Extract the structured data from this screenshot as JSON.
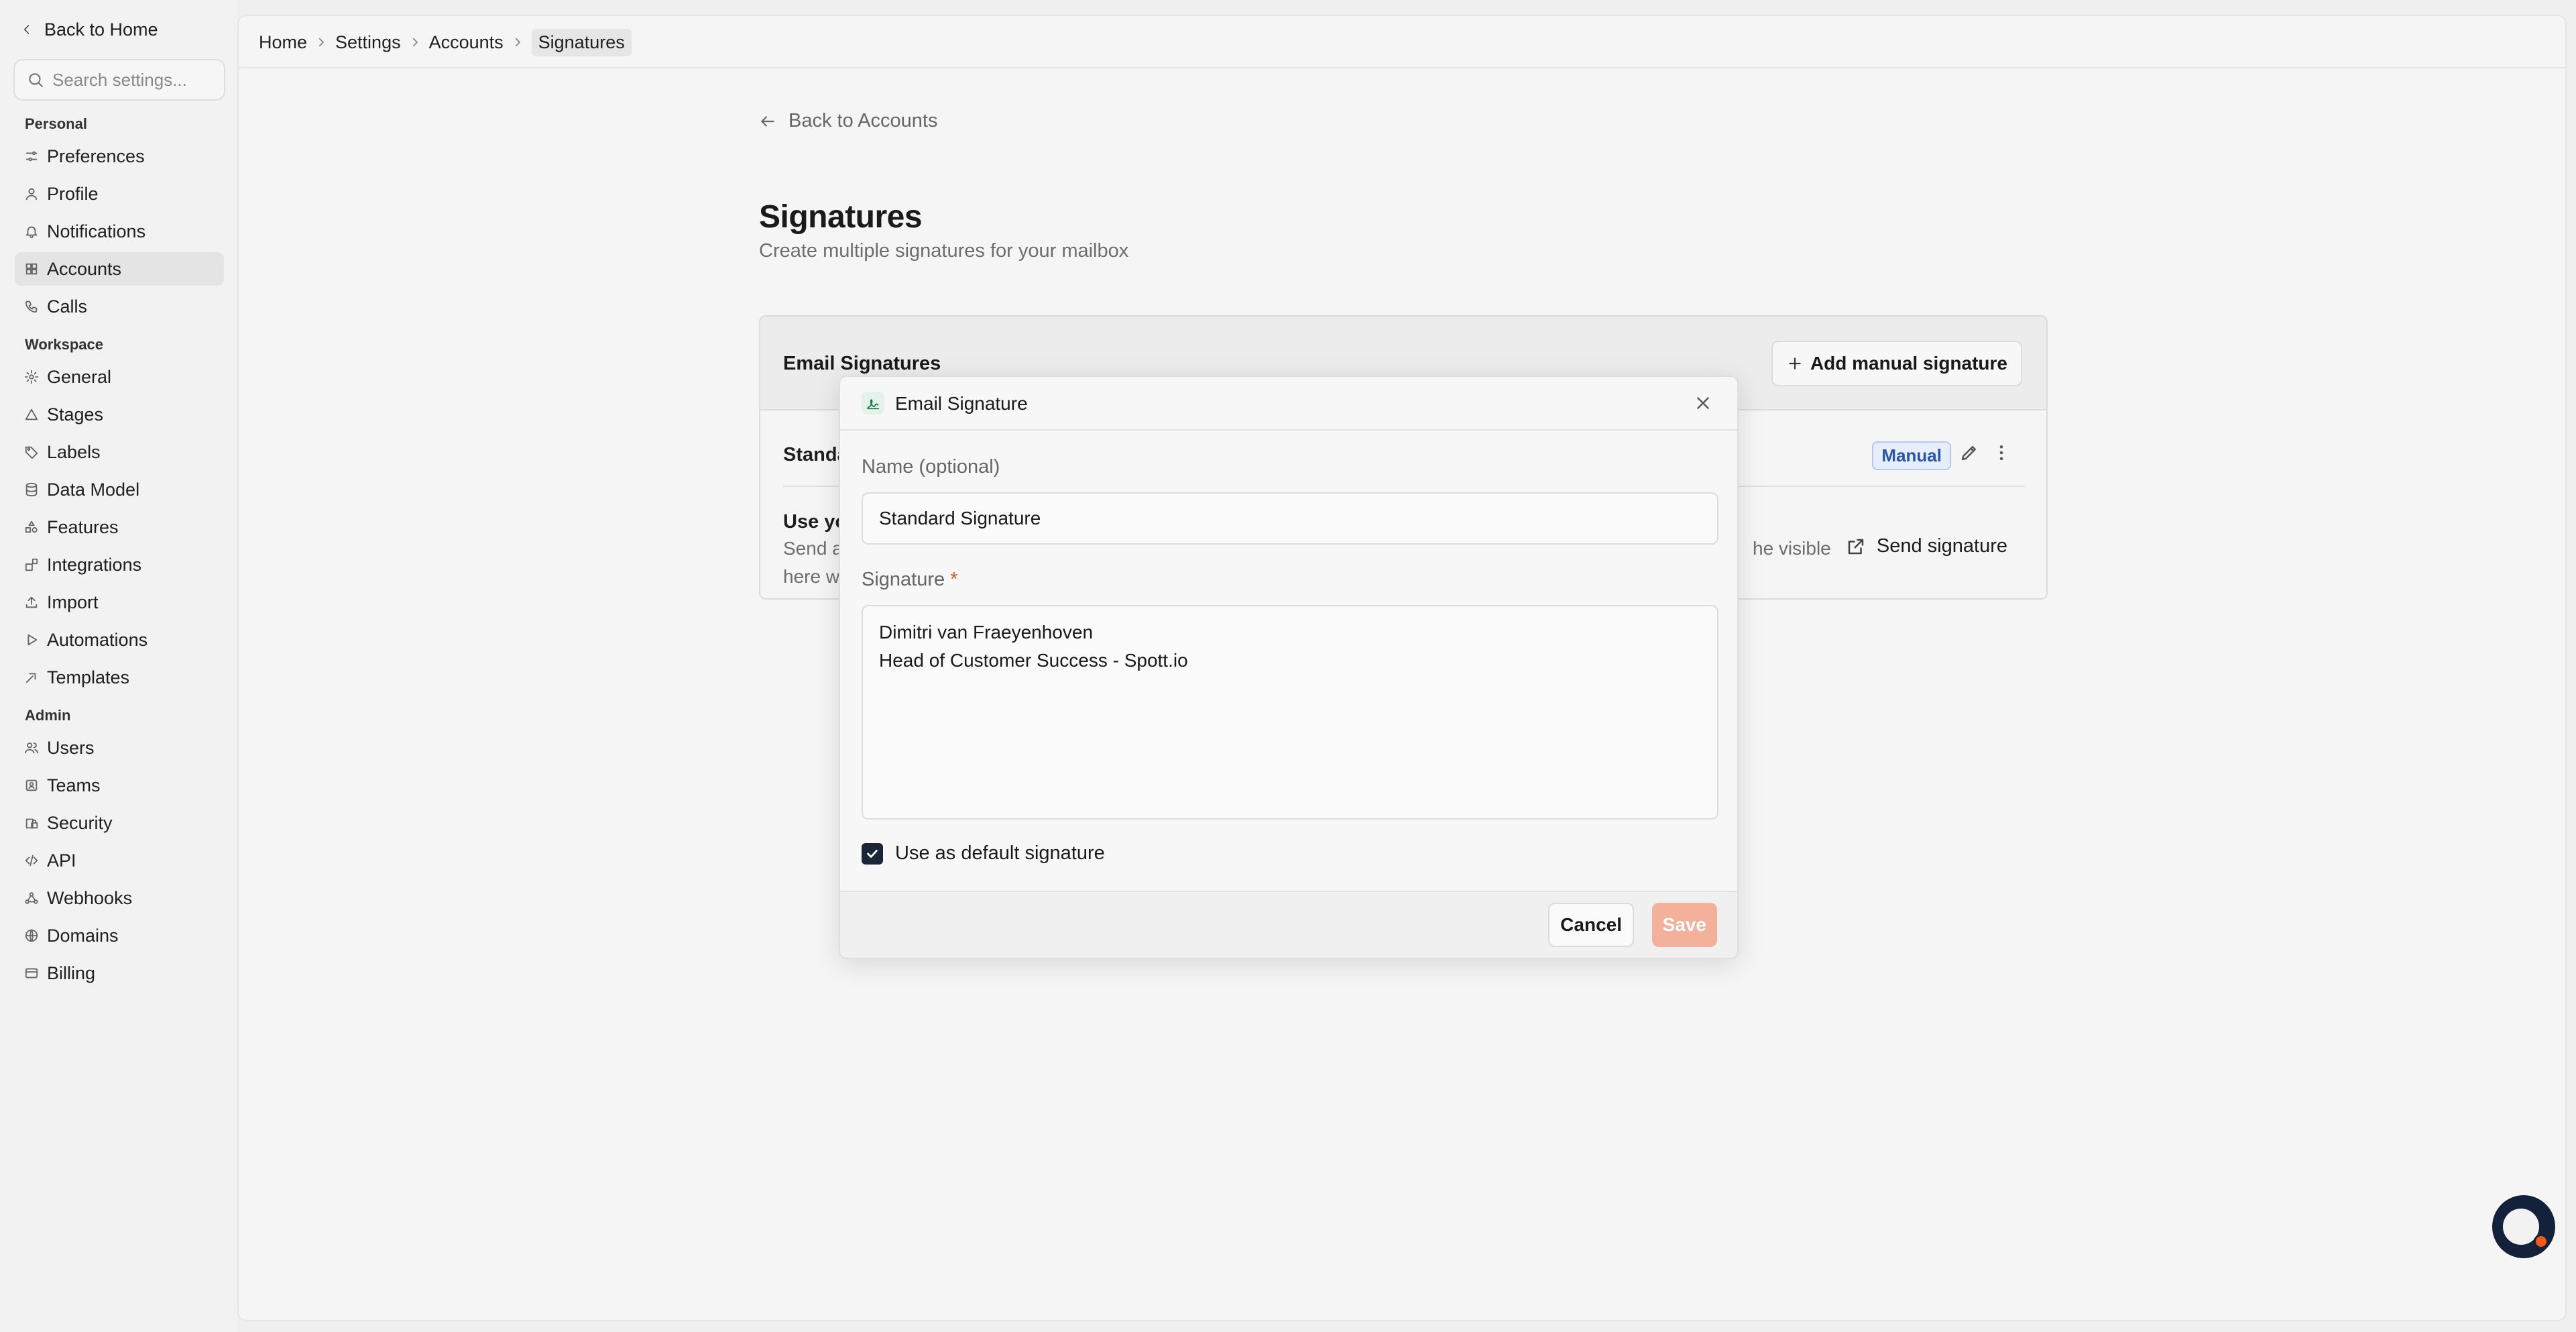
{
  "sidebar": {
    "back_label": "Back to Home",
    "search_placeholder": "Search settings...",
    "sections": {
      "personal": "Personal",
      "workspace": "Workspace",
      "admin": "Admin"
    },
    "items": [
      {
        "label": "Preferences",
        "icon": "sliders-icon"
      },
      {
        "label": "Profile",
        "icon": "user-icon"
      },
      {
        "label": "Notifications",
        "icon": "bell-icon"
      },
      {
        "label": "Accounts",
        "icon": "grid-icon",
        "active": true
      },
      {
        "label": "Calls",
        "icon": "phone-icon"
      },
      {
        "label": "General",
        "icon": "gear-icon"
      },
      {
        "label": "Stages",
        "icon": "triangle-icon"
      },
      {
        "label": "Labels",
        "icon": "tag-icon"
      },
      {
        "label": "Data Model",
        "icon": "database-icon"
      },
      {
        "label": "Features",
        "icon": "shapes-icon"
      },
      {
        "label": "Integrations",
        "icon": "blocks-icon"
      },
      {
        "label": "Import",
        "icon": "upload-icon"
      },
      {
        "label": "Automations",
        "icon": "play-icon"
      },
      {
        "label": "Templates",
        "icon": "template-icon"
      },
      {
        "label": "Users",
        "icon": "users-icon"
      },
      {
        "label": "Teams",
        "icon": "team-icon"
      },
      {
        "label": "Security",
        "icon": "lock-icon"
      },
      {
        "label": "API",
        "icon": "code-icon"
      },
      {
        "label": "Webhooks",
        "icon": "webhook-icon"
      },
      {
        "label": "Domains",
        "icon": "globe-icon"
      },
      {
        "label": "Billing",
        "icon": "card-icon"
      }
    ]
  },
  "breadcrumb": [
    "Home",
    "Settings",
    "Accounts",
    "Signatures"
  ],
  "page": {
    "back_label": "Back to Accounts",
    "title": "Signatures",
    "subtitle": "Create multiple signatures for your mailbox"
  },
  "card": {
    "title": "Email Signatures",
    "add_button": "Add manual signature",
    "row_name_visible": "Standa",
    "badge": "Manual",
    "use_title_visible": "Use yo",
    "use_desc_line1_visible": "Send a",
    "use_desc_line2_visible": "here w",
    "use_desc_tail_visible": "he visible",
    "send_button": "Send signature"
  },
  "modal": {
    "title": "Email Signature",
    "name_label": "Name (optional)",
    "name_value": "Standard Signature",
    "signature_label": "Signature",
    "required_mark": "*",
    "signature_value": "Dimitri van Fraeyenhoven\nHead of Customer Success - Spott.io",
    "default_checkbox_label": "Use as default signature",
    "default_checked": true,
    "cancel_label": "Cancel",
    "save_label": "Save"
  },
  "colors": {
    "accent_orange": "#ee5a1c",
    "save_disabled": "#f3b09a",
    "badge_blue": "#2955a8",
    "checkbox_dark": "#1a2638",
    "chat_navy": "#13213a"
  }
}
